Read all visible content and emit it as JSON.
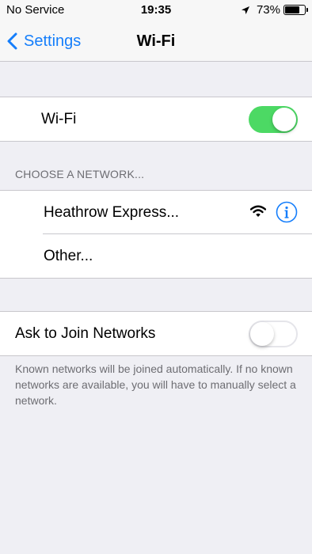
{
  "status_bar": {
    "carrier": "No Service",
    "time": "19:35",
    "battery_percent": "73%",
    "battery_level": 0.73,
    "location_icon": "location-arrow-icon"
  },
  "nav": {
    "back_label": "Settings",
    "title": "Wi-Fi"
  },
  "wifi_toggle": {
    "label": "Wi-Fi",
    "on": true
  },
  "networks_section": {
    "header": "CHOOSE A NETWORK...",
    "networks": [
      {
        "name": "Heathrow Express...",
        "icon": "wifi-signal-icon",
        "info_icon": "info-icon"
      },
      {
        "name": "Other..."
      }
    ]
  },
  "ask_to_join": {
    "label": "Ask to Join Networks",
    "on": false,
    "footer": "Known networks will be joined automatically. If no known networks are available, you will have to manually select a network."
  },
  "colors": {
    "accent": "#157efb",
    "toggle_on": "#4cd964",
    "background": "#efeff4"
  }
}
